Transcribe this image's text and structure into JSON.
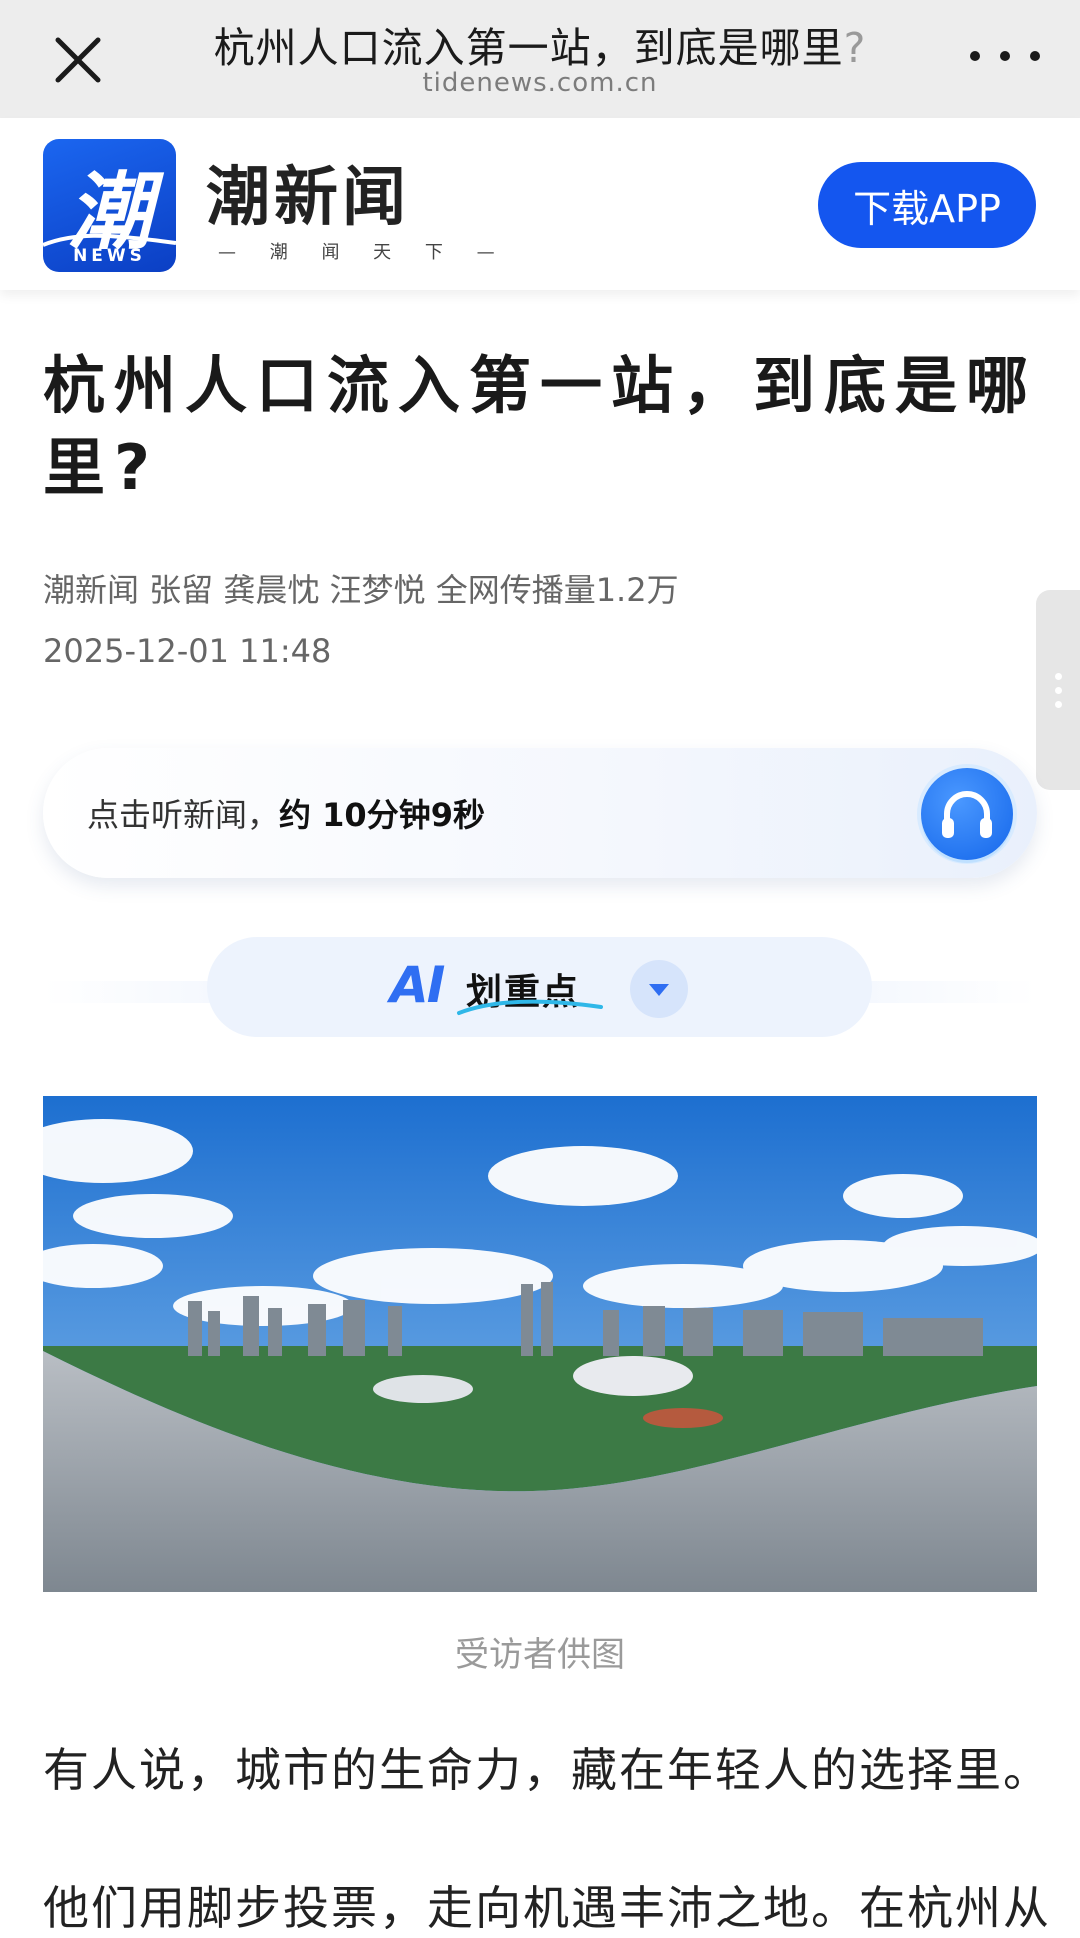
{
  "browser": {
    "title": "杭州人口流入第一站，到底是哪里",
    "title_tail": "?",
    "url": "tidenews.com.cn",
    "close_icon": "close-icon",
    "more_icon": "more-icon"
  },
  "brand": {
    "logo_char": "潮",
    "logo_news": "NEWS",
    "name": "潮新闻",
    "slogan": "— 潮 闻 天 下 —",
    "download_label": "下载APP",
    "accent": "#1456ef"
  },
  "article": {
    "headline": "杭州人口流入第一站，到底是哪里?",
    "meta": "潮新闻 张留 龚晨忱 汪梦悦 全网传播量1.2万",
    "published": "2025-12-01 11:48",
    "listen": {
      "label": "点击听新闻，",
      "duration": "约 10分钟9秒",
      "icon": "headphones-icon"
    },
    "ai": {
      "prefix": "AI",
      "label": "划重点",
      "toggle_icon": "caret-down-icon"
    },
    "image_caption": "受访者供图",
    "paragraphs": [
      "有人说，城市的生命力，藏在年轻人的选择里。",
      "他们用脚步投票，走向机遇丰沛之地。在杭州从"
    ]
  }
}
